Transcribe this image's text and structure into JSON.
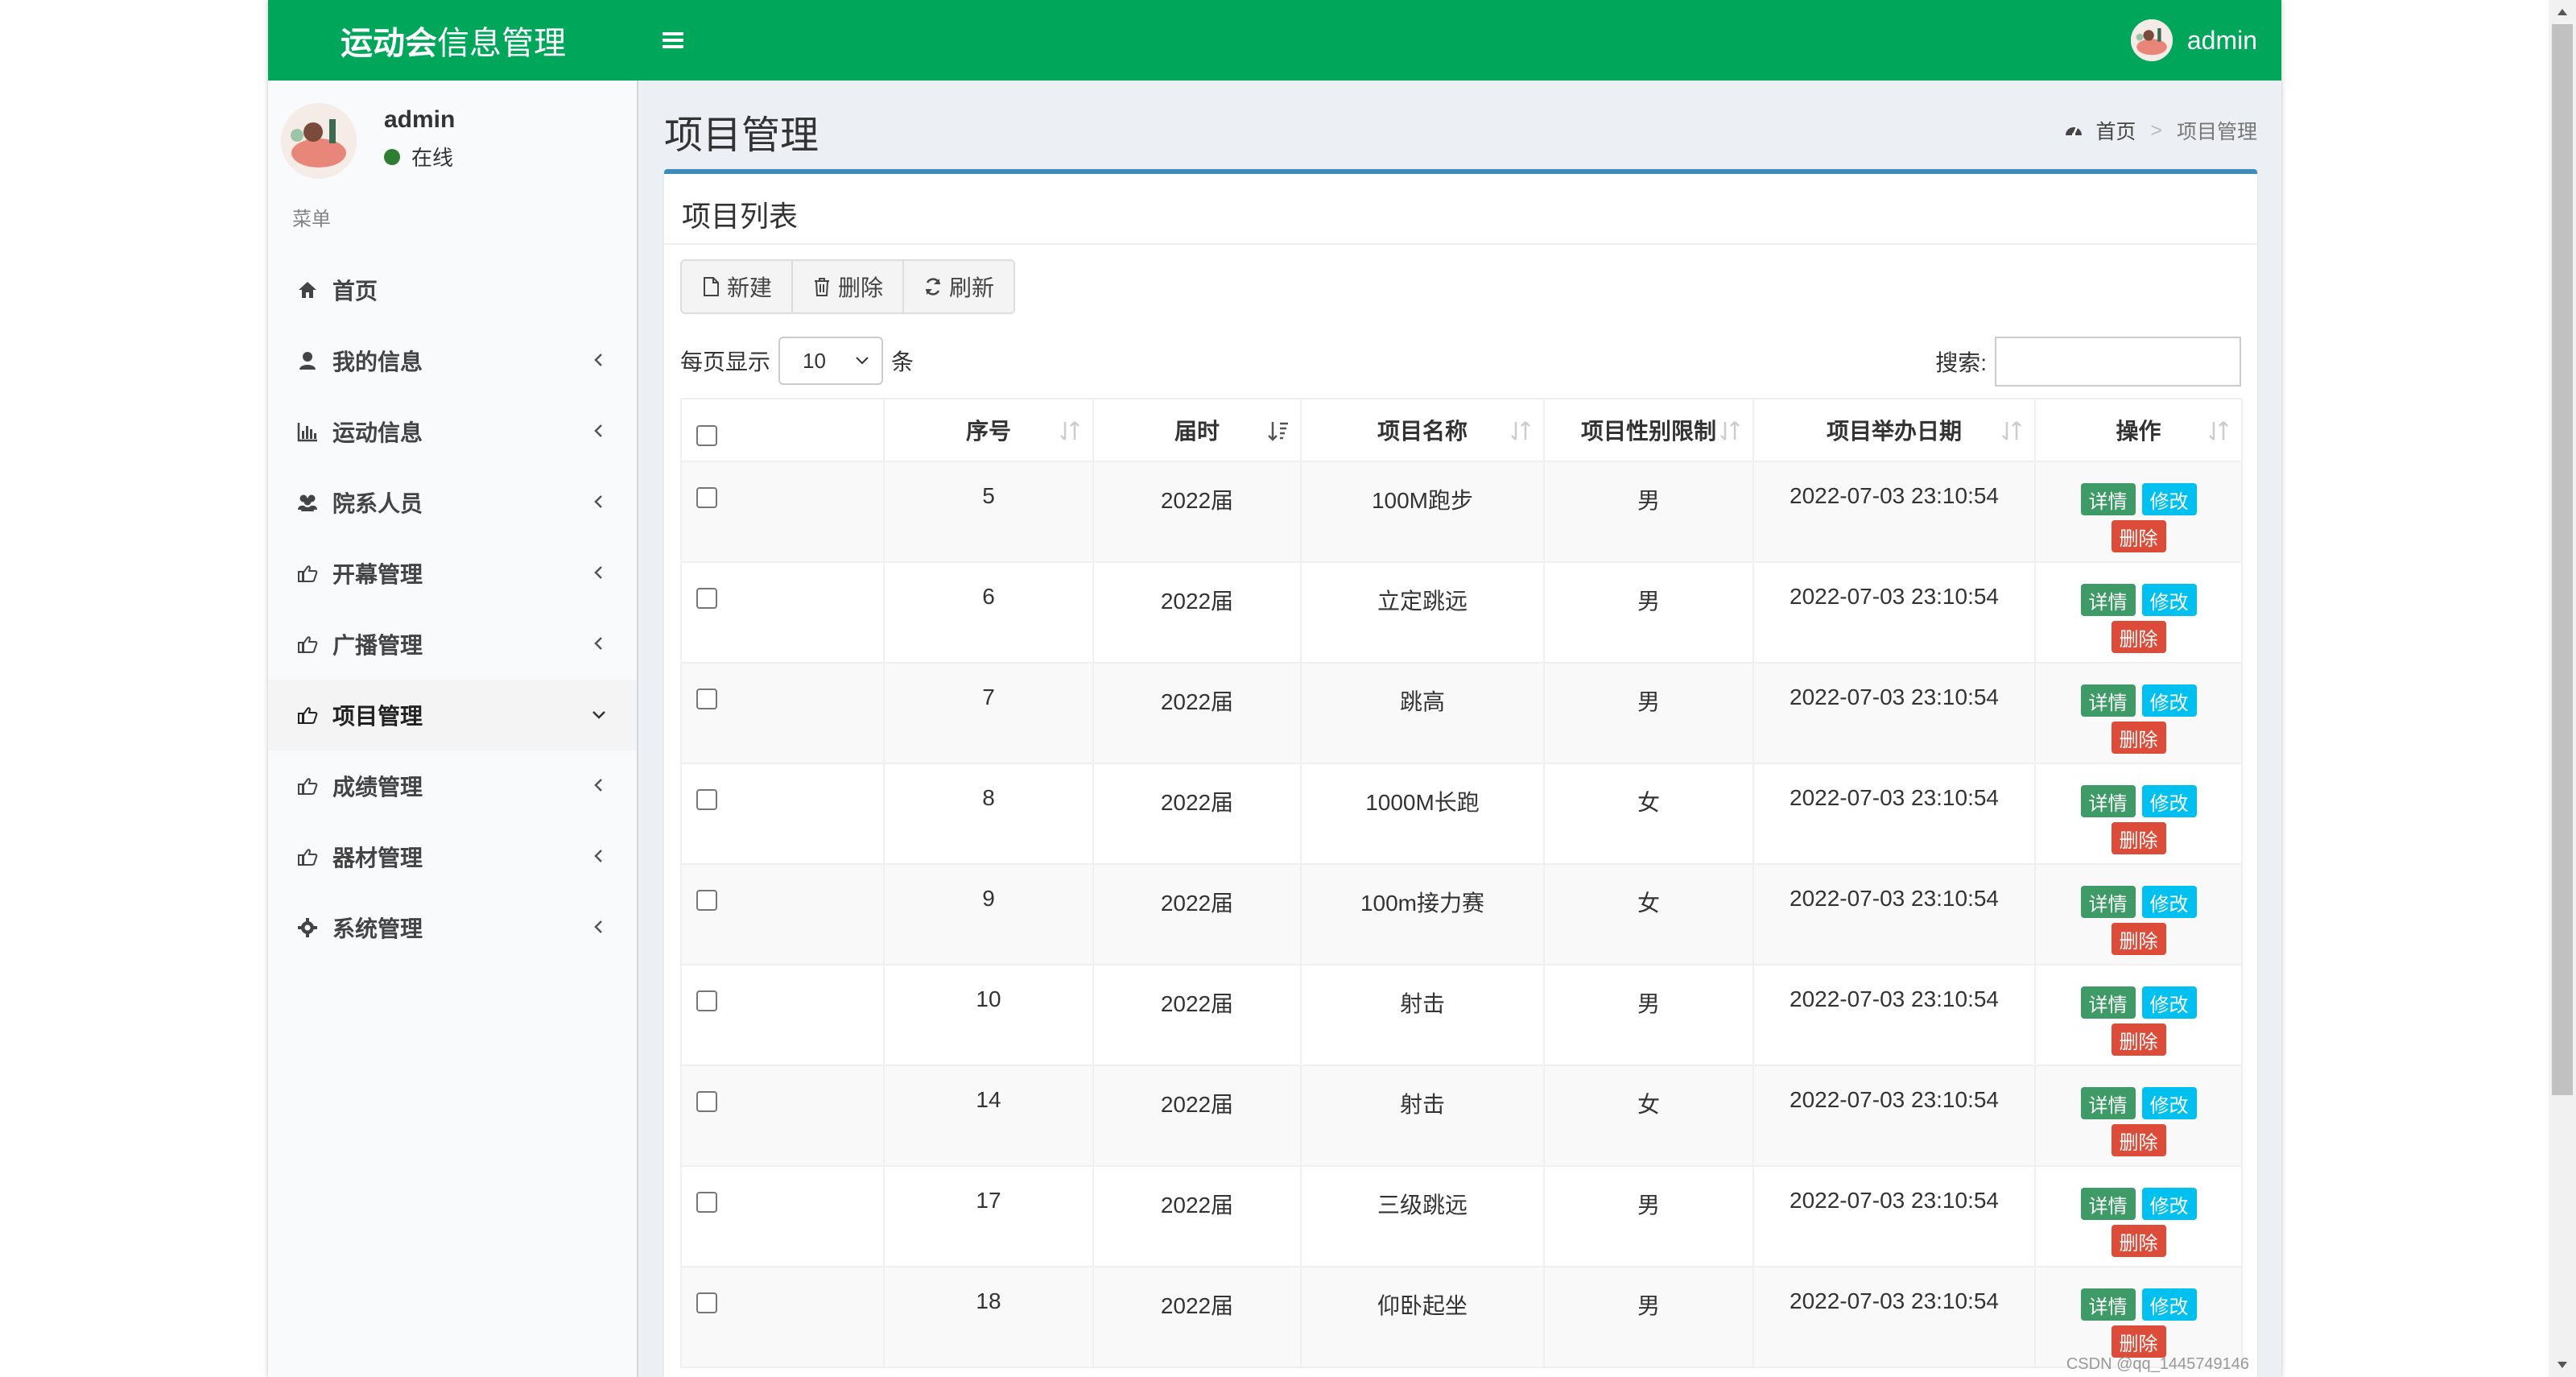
{
  "header": {
    "logo_bold": "运动会",
    "logo_light": "信息管理",
    "username": "admin"
  },
  "sidebar": {
    "username": "admin",
    "status": "在线",
    "menu_header": "菜单",
    "items": [
      {
        "label": "首页",
        "icon": "home-icon"
      },
      {
        "label": "我的信息",
        "icon": "user-icon"
      },
      {
        "label": "运动信息",
        "icon": "bar-chart-icon"
      },
      {
        "label": "院系人员",
        "icon": "users-icon"
      },
      {
        "label": "开幕管理",
        "icon": "hand-point-icon"
      },
      {
        "label": "广播管理",
        "icon": "hand-point-icon"
      },
      {
        "label": "项目管理",
        "icon": "hand-point-icon",
        "active": true
      },
      {
        "label": "成绩管理",
        "icon": "hand-point-icon"
      },
      {
        "label": "器材管理",
        "icon": "hand-point-icon"
      },
      {
        "label": "系统管理",
        "icon": "gear-icon"
      }
    ]
  },
  "page": {
    "title": "项目管理",
    "breadcrumb": {
      "home": "首页",
      "current": "项目管理"
    }
  },
  "box": {
    "title": "项目列表",
    "buttons": {
      "new": "新建",
      "delete": "删除",
      "refresh": "刷新"
    },
    "length": {
      "prefix": "每页显示",
      "value": "10",
      "suffix": "条"
    },
    "search_label": "搜索:"
  },
  "table": {
    "columns": [
      "序号",
      "届时",
      "项目名称",
      "项目性别限制",
      "项目举办日期",
      "操作"
    ],
    "actions": {
      "detail": "详情",
      "edit": "修改",
      "delete": "删除"
    },
    "rows": [
      [
        "5",
        "2022届",
        "100M跑步",
        "男",
        "2022-07-03 23:10:54"
      ],
      [
        "6",
        "2022届",
        "立定跳远",
        "男",
        "2022-07-03 23:10:54"
      ],
      [
        "7",
        "2022届",
        "跳高",
        "男",
        "2022-07-03 23:10:54"
      ],
      [
        "8",
        "2022届",
        "1000M长跑",
        "女",
        "2022-07-03 23:10:54"
      ],
      [
        "9",
        "2022届",
        "100m接力赛",
        "女",
        "2022-07-03 23:10:54"
      ],
      [
        "10",
        "2022届",
        "射击",
        "男",
        "2022-07-03 23:10:54"
      ],
      [
        "14",
        "2022届",
        "射击",
        "女",
        "2022-07-03 23:10:54"
      ],
      [
        "17",
        "2022届",
        "三级跳远",
        "男",
        "2022-07-03 23:10:54"
      ],
      [
        "18",
        "2022届",
        "仰卧起坐",
        "男",
        "2022-07-03 23:10:54"
      ]
    ]
  },
  "watermark": "CSDN @qq_1445749146"
}
